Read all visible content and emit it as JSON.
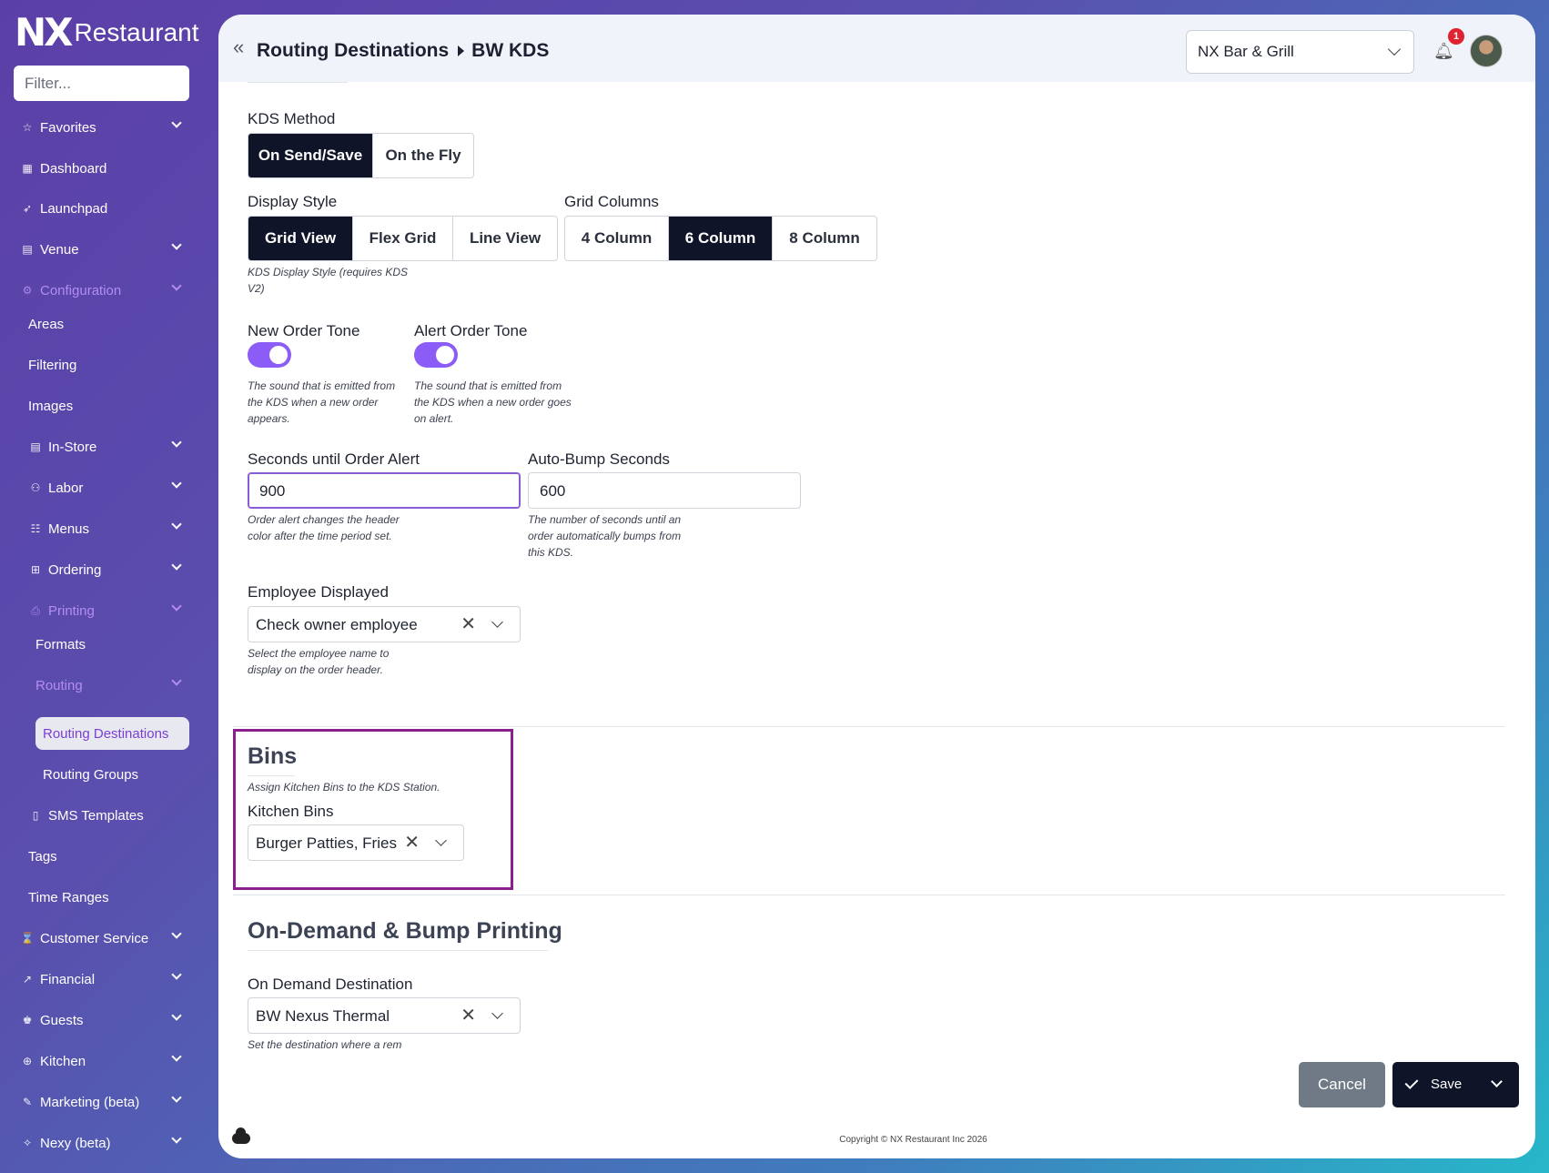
{
  "app": {
    "logo_mark": "NX",
    "logo_text": "Restaurant"
  },
  "sidebar": {
    "filter_placeholder": "Filter...",
    "items": [
      {
        "label": "Favorites",
        "icon": "star-icon"
      },
      {
        "label": "Dashboard",
        "icon": "grid-icon"
      },
      {
        "label": "Launchpad",
        "icon": "rocket-icon"
      },
      {
        "label": "Venue",
        "icon": "building-icon"
      },
      {
        "label": "Configuration",
        "icon": "gear-icon"
      },
      {
        "label": "Areas"
      },
      {
        "label": "Filtering"
      },
      {
        "label": "Images"
      },
      {
        "label": "In-Store",
        "icon": "store-icon"
      },
      {
        "label": "Labor",
        "icon": "users-icon"
      },
      {
        "label": "Menus",
        "icon": "menu-icon"
      },
      {
        "label": "Ordering",
        "icon": "cart-icon"
      },
      {
        "label": "Printing",
        "icon": "printer-icon"
      },
      {
        "label": "Formats"
      },
      {
        "label": "Routing"
      },
      {
        "label": "Routing Destinations"
      },
      {
        "label": "Routing Groups"
      },
      {
        "label": "SMS Templates",
        "icon": "phone-icon"
      },
      {
        "label": "Tags"
      },
      {
        "label": "Time Ranges"
      },
      {
        "label": "Customer Service",
        "icon": "support-icon"
      },
      {
        "label": "Financial",
        "icon": "chart-icon"
      },
      {
        "label": "Guests",
        "icon": "guest-icon"
      },
      {
        "label": "Kitchen",
        "icon": "kitchen-icon"
      },
      {
        "label": "Marketing (beta)",
        "icon": "megaphone-icon"
      },
      {
        "label": "Nexy (beta)",
        "icon": "sparkle-icon"
      }
    ]
  },
  "header": {
    "breadcrumb_parent": "Routing Destinations",
    "breadcrumb_current": "BW KDS",
    "venue_select": "NX Bar & Grill",
    "notification_count": "1"
  },
  "form": {
    "kds_method": {
      "label": "KDS Method",
      "options": [
        "On Send/Save",
        "On the Fly"
      ],
      "selected": "On Send/Save"
    },
    "display_style": {
      "label": "Display Style",
      "options": [
        "Grid View",
        "Flex Grid",
        "Line View"
      ],
      "selected": "Grid View",
      "help": "KDS Display Style (requires KDS V2)"
    },
    "grid_columns": {
      "label": "Grid Columns",
      "options": [
        "4 Column",
        "6 Column",
        "8 Column"
      ],
      "selected": "6 Column"
    },
    "new_order_tone": {
      "label": "New Order Tone",
      "enabled": true,
      "help": "The sound that is emitted from the KDS when a new order appears."
    },
    "alert_order_tone": {
      "label": "Alert Order Tone",
      "enabled": true,
      "help": "The sound that is emitted from the KDS when a new order goes on alert."
    },
    "seconds_until_alert": {
      "label": "Seconds until Order Alert",
      "value": "900",
      "help": "Order alert changes the header color after the time period set."
    },
    "auto_bump_seconds": {
      "label": "Auto-Bump Seconds",
      "value": "600",
      "help": "The number of seconds until an order automatically bumps from this KDS."
    },
    "employee_displayed": {
      "label": "Employee Displayed",
      "value": "Check owner employee",
      "help": "Select the employee name to display on the order header."
    },
    "bins": {
      "title": "Bins",
      "help": "Assign Kitchen Bins to the KDS Station.",
      "kitchen_bins_label": "Kitchen Bins",
      "kitchen_bins_value": "Burger Patties, Fries"
    },
    "on_demand": {
      "title": "On-Demand & Bump Printing",
      "destination_label": "On Demand Destination",
      "destination_value": "BW Nexus Thermal",
      "help": "Set the destination where a remote chit prints when you hit"
    }
  },
  "actions": {
    "cancel": "Cancel",
    "save": "Save"
  },
  "footer": {
    "copyright": "Copyright © NX Restaurant Inc 2026"
  },
  "colors": {
    "accent": "#8b5cf6",
    "dark": "#0f1428",
    "highlight_box": "#8a1f8e"
  }
}
